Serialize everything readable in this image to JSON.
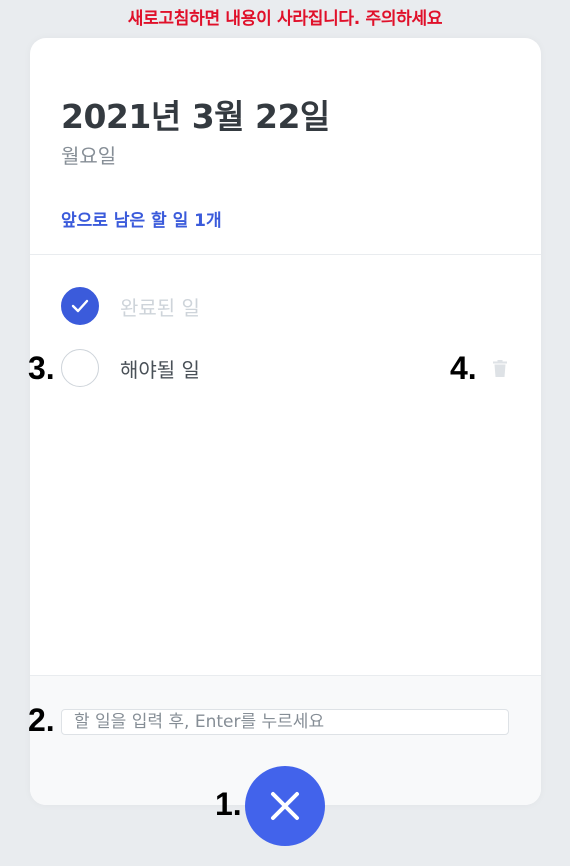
{
  "warning": "새로고침하면 내용이 사라집니다. 주의하세요",
  "header": {
    "date": "2021년 3월 22일",
    "day": "월요일",
    "tasks_left": "앞으로 남은 할 일 1개"
  },
  "todos": [
    {
      "text": "완료된 일",
      "done": true
    },
    {
      "text": "해야될 일",
      "done": false
    }
  ],
  "input": {
    "placeholder": "할 일을 입력 후, Enter를 누르세요",
    "value": ""
  },
  "annotations": {
    "fab": "1.",
    "input": "2.",
    "checkbox": "3.",
    "delete": "4."
  },
  "colors": {
    "accent": "#4263eb",
    "warning": "#e0102a",
    "background": "#e9ecef"
  },
  "icons": {
    "fab": "close-icon",
    "done": "check-icon",
    "delete": "trash-icon"
  }
}
